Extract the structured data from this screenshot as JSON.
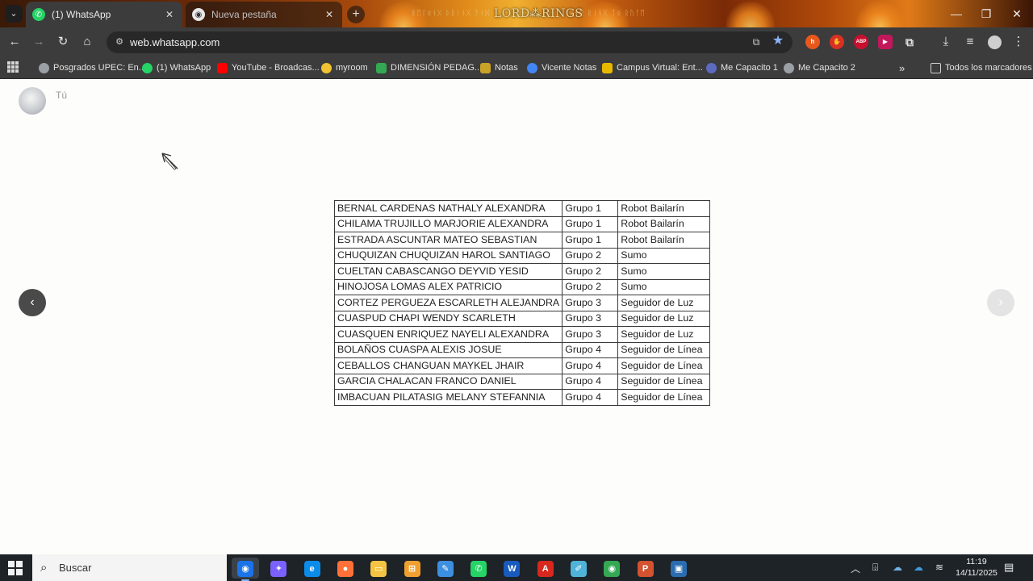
{
  "browser": {
    "tabs": [
      {
        "label": "(1) WhatsApp",
        "active": true,
        "icon": "whatsapp-icon"
      },
      {
        "label": "Nueva pestaña",
        "active": false,
        "icon": "chrome-icon"
      }
    ],
    "theme_title": "LORD⁂RINGS",
    "theme_script_left": "ᛒᛖᛚᛟᚾᚷ ᚦᚱᛁᚾᚷ ᚨᚾᛞ",
    "theme_script_right": "ᛟᚾᛖ ᚱᛁᚾᚷ ᛏᛟ ᚱᚢᛚᛖ",
    "url": "web.whatsapp.com",
    "extensions": [
      {
        "name": "honey-extension-icon",
        "text": "h",
        "color": "#e8581c"
      },
      {
        "name": "hand-extension-icon",
        "text": "✋",
        "color": "#d93025"
      },
      {
        "name": "adblock-plus-icon",
        "text": "ABP",
        "color": "#c8102e"
      },
      {
        "name": "video-extension-icon",
        "text": "▶",
        "color": "#c2185b"
      },
      {
        "name": "extensions-puzzle-icon",
        "text": "⧉",
        "color": "transparent"
      }
    ]
  },
  "bookmarks": [
    {
      "label": "Posgrados UPEC: En...",
      "color": "#9aa0a6"
    },
    {
      "label": "(1) WhatsApp",
      "color": "#25d366"
    },
    {
      "label": "YouTube - Broadcas...",
      "color": "#ff0000"
    },
    {
      "label": "myroom",
      "color": "#f1c232"
    },
    {
      "label": "DIMENSIÓN PEDAG...",
      "color": "#34a853"
    },
    {
      "label": "Notas",
      "color": "#c9a227"
    },
    {
      "label": "Vicente Notas",
      "color": "#4285f4"
    },
    {
      "label": "Campus Virtual: Ent...",
      "color": "#e6b800"
    },
    {
      "label": "Me Capacito 1",
      "color": "#5c6bc0"
    },
    {
      "label": "Me Capacito 2",
      "color": "#9aa0a6"
    }
  ],
  "bookmarks_overflow": "»",
  "all_bookmarks": "Todos los marcadores",
  "viewer": {
    "sender": "Tú",
    "table": [
      [
        "BERNAL CARDENAS NATHALY ALEXANDRA",
        "Grupo 1",
        "Robot Bailarín"
      ],
      [
        "CHILAMA TRUJILLO MARJORIE ALEXANDRA",
        "Grupo 1",
        "Robot Bailarín"
      ],
      [
        "ESTRADA ASCUNTAR MATEO SEBASTIAN",
        "Grupo 1",
        "Robot Bailarín"
      ],
      [
        "CHUQUIZAN CHUQUIZAN HAROL SANTIAGO",
        "Grupo 2",
        "Sumo"
      ],
      [
        "CUELTAN CABASCANGO DEYVID YESID",
        "Grupo 2",
        "Sumo"
      ],
      [
        "HINOJOSA LOMAS ALEX PATRICIO",
        "Grupo 2",
        "Sumo"
      ],
      [
        "CORTEZ PERGUEZA ESCARLETH ALEJANDRA",
        "Grupo 3",
        "Seguidor de Luz"
      ],
      [
        "CUASPUD CHAPI WENDY SCARLETH",
        "Grupo 3",
        "Seguidor de Luz"
      ],
      [
        "CUASQUEN ENRIQUEZ NAYELI ALEXANDRA",
        "Grupo 3",
        "Seguidor de Luz"
      ],
      [
        "BOLAÑOS CUASPA ALEXIS JOSUE",
        "Grupo 4",
        "Seguidor de Línea"
      ],
      [
        "CEBALLOS CHANGUAN MAYKEL JHAIR",
        "Grupo 4",
        "Seguidor de Línea"
      ],
      [
        "GARCIA CHALACAN FRANCO DANIEL",
        "Grupo 4",
        "Seguidor de Línea"
      ],
      [
        "IMBACUAN PILATASIG MELANY STEFANNIA",
        "Grupo 4",
        "Seguidor de Línea"
      ]
    ]
  },
  "taskbar": {
    "search_placeholder": "Buscar",
    "apps": [
      {
        "name": "chrome-taskbar-icon",
        "glyph": "◉",
        "bg": "#1a73e8",
        "active": true
      },
      {
        "name": "copilot-taskbar-icon",
        "glyph": "✦",
        "bg": "#7b61ff",
        "active": false
      },
      {
        "name": "edge-taskbar-icon",
        "glyph": "e",
        "bg": "#0c8ce9",
        "active": false
      },
      {
        "name": "firefox-taskbar-icon",
        "glyph": "●",
        "bg": "#ff7139",
        "active": false
      },
      {
        "name": "file-explorer-taskbar-icon",
        "glyph": "▭",
        "bg": "#f4c542",
        "active": false
      },
      {
        "name": "store-taskbar-icon",
        "glyph": "⊞",
        "bg": "#f0a030",
        "active": false
      },
      {
        "name": "folder-pen-taskbar-icon",
        "glyph": "✎",
        "bg": "#3d8fe0",
        "active": false
      },
      {
        "name": "whatsapp-taskbar-icon",
        "glyph": "✆",
        "bg": "#25d366",
        "active": false
      },
      {
        "name": "word-taskbar-icon",
        "glyph": "W",
        "bg": "#185abd",
        "active": false
      },
      {
        "name": "acrobat-taskbar-icon",
        "glyph": "A",
        "bg": "#d8281e",
        "active": false
      },
      {
        "name": "notepad-taskbar-icon",
        "glyph": "✐",
        "bg": "#4fb3d9",
        "active": false
      },
      {
        "name": "chrome-profile-taskbar-icon",
        "glyph": "◉",
        "bg": "#34a853",
        "active": false
      },
      {
        "name": "powerpoint-taskbar-icon",
        "glyph": "P",
        "bg": "#d35230",
        "active": false
      },
      {
        "name": "remote-desktop-taskbar-icon",
        "glyph": "▣",
        "bg": "#2b6cb0",
        "active": false
      }
    ],
    "time": "11:19",
    "date": "14/11/2025"
  }
}
